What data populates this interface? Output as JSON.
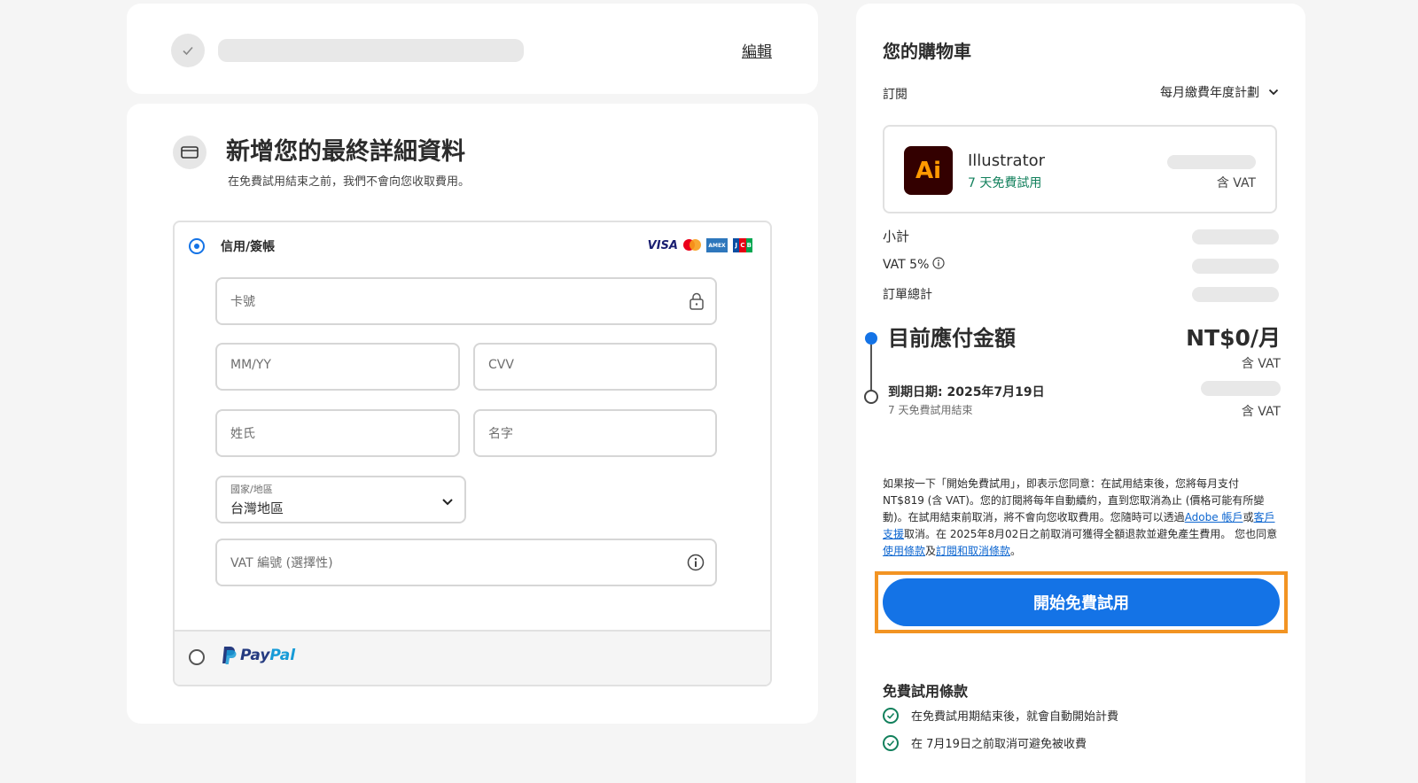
{
  "step": {
    "edit_label": "編輯"
  },
  "details": {
    "title": "新增您的最終詳細資料",
    "subtitle": "在免費試用結束之前，我們不會向您收取費用。",
    "credit_label": "信用/簽帳",
    "card_logos": [
      "VISA",
      "mastercard",
      "AMEX",
      "JCB"
    ],
    "fields": {
      "card_number": "卡號",
      "expiry": "MM/YY",
      "cvv": "CVV",
      "last_name": "姓氏",
      "first_name": "名字",
      "country_label": "國家/地區",
      "country_value": "台灣地區",
      "vat_number": "VAT 編號 (選擇性)"
    },
    "paypal_label": "PayPal"
  },
  "cart": {
    "title": "您的購物車",
    "subscription_label": "訂閱",
    "plan": "每月繳費年度計劃",
    "product": {
      "name": "Illustrator",
      "trial": "7 天免費試用",
      "vat_note": "含 VAT",
      "logo_text": "Ai"
    },
    "summary": {
      "subtotal": "小計",
      "vat": "VAT 5%",
      "total": "訂單總計"
    },
    "due_now_label": "目前應付金額",
    "due_now_amount": "NT$0/月",
    "due_now_vat": "含 VAT",
    "end_date": "到期日期: 2025年7月19日",
    "end_sub": "7 天免費試用結束",
    "end_vat": "含 VAT",
    "terms": {
      "part1": "如果按一下「開始免費試用」，即表示您同意：在試用結束後，您將每月支付 NT$819 (含 VAT)。您的訂閱將每年自動續約，直到您取消為止 (價格可能有所變動)。在試用結束前取消，將不會向您收取費用。您隨時可以透過",
      "link_account": "Adobe 帳戶",
      "part2": "或",
      "link_support": "客戶支援",
      "part3": "取消。在 2025年8月02日之前取消可獲得全額退款並避免產生費用。 您也同意",
      "link_terms": "使用條款",
      "part4": "及",
      "link_cancel": "訂閱和取消條款",
      "part5": "。"
    },
    "cta_label": "開始免費試用",
    "trial_terms_title": "免費試用條款",
    "trial_items": [
      "在免費試用期結束後，就會自動開始計費",
      "在 7月19日之前取消可避免被收費"
    ]
  },
  "colors": {
    "accent": "#1473e6",
    "highlight": "#f29423",
    "success": "#12805c"
  }
}
